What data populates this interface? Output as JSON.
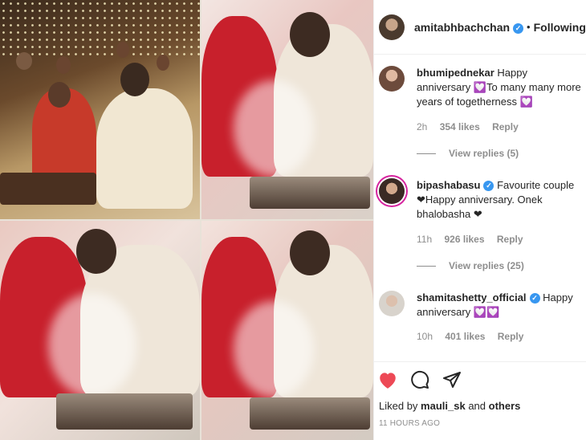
{
  "post": {
    "author": "amitabhbachchan",
    "follow_status": "Following"
  },
  "comments": [
    {
      "user": "bhumipednekar",
      "text": "Happy anniversary 💟To many many more years of togetherness 💟",
      "time": "2h",
      "likes": "354 likes",
      "reply": "Reply",
      "view_replies": "View replies (5)"
    },
    {
      "user": "bipashabasu",
      "text": "Favourite couple ❤Happy anniversary. Onek bhalobasha ❤",
      "time": "11h",
      "likes": "926 likes",
      "reply": "Reply",
      "view_replies": "View replies (25)"
    },
    {
      "user": "shamitashetty_official",
      "text": "Happy anniversary 💟💟",
      "time": "10h",
      "likes": "401 likes",
      "reply": "Reply"
    }
  ],
  "footer": {
    "liked_prefix": "Liked by",
    "liked_user": "mauli_sk",
    "liked_and": "and",
    "liked_others": "others",
    "timestamp": "11 HOURS AGO"
  },
  "colors": {
    "like_red": "#ed4956",
    "verified_blue": "#3897f0",
    "muted": "#8e8e8e"
  },
  "icons": [
    "heart-icon",
    "comment-icon",
    "share-icon",
    "verified-badge-icon"
  ]
}
